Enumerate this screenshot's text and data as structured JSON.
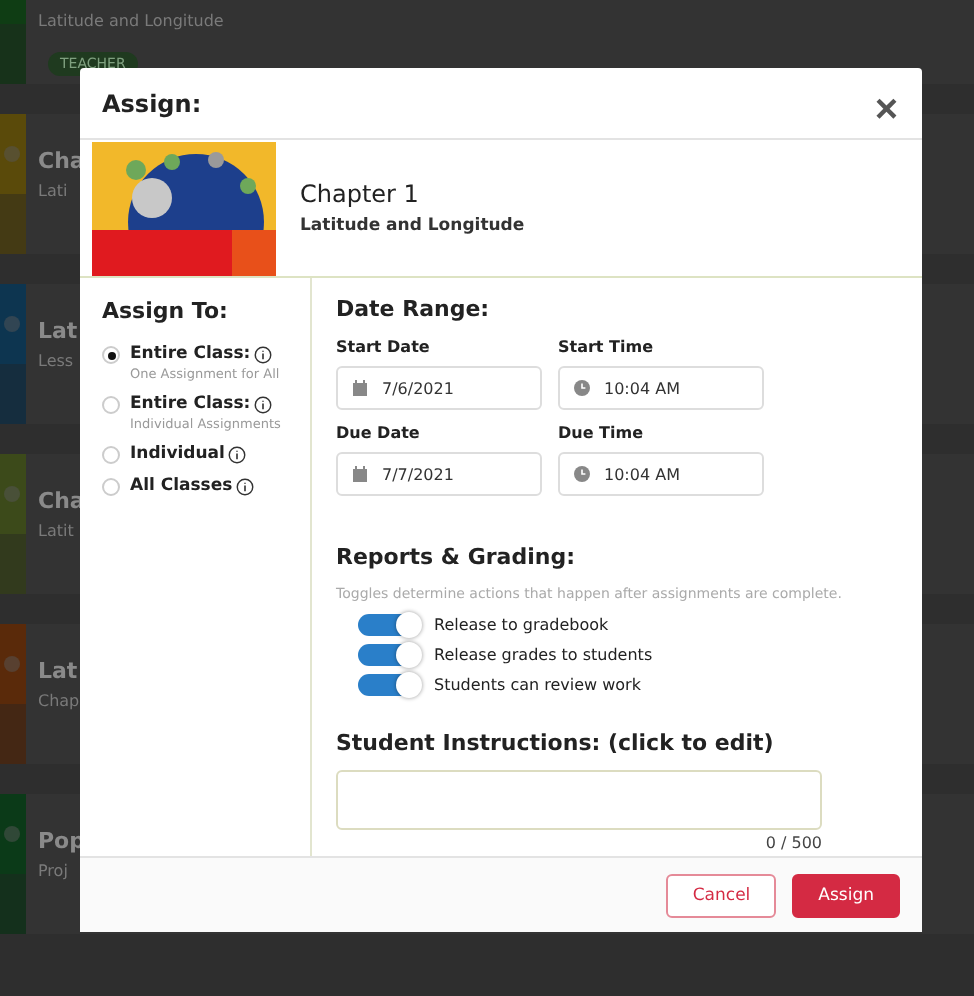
{
  "background_cards": [
    {
      "subtitle": "Latitude and Longitude",
      "badge": "TEACHER"
    },
    {
      "title": "Cha",
      "subtitle": "Lati"
    },
    {
      "title": "Lat",
      "subtitle": "Less"
    },
    {
      "title": "Cha",
      "subtitle": "Latit"
    },
    {
      "title": "Lat",
      "subtitle": "Chap"
    },
    {
      "title": "Pop",
      "subtitle": "Proj"
    }
  ],
  "dialog": {
    "title": "Assign:",
    "close": "×",
    "resource": {
      "title": "Chapter 1",
      "subtitle": "Latitude and Longitude"
    },
    "assign_to": {
      "heading": "Assign To:",
      "options": [
        {
          "label": "Entire Class:",
          "note": "One Assignment for All",
          "selected": true
        },
        {
          "label": "Entire Class:",
          "note": "Individual Assignments",
          "selected": false
        },
        {
          "label": "Individual",
          "selected": false
        },
        {
          "label": "All Classes",
          "selected": false
        }
      ]
    },
    "date_range": {
      "heading": "Date Range:",
      "fields": [
        {
          "label": "Start Date",
          "kind": "date",
          "value": "7/6/2021"
        },
        {
          "label": "Start Time",
          "kind": "time",
          "value": "10:04 AM"
        },
        {
          "label": "Due Date",
          "kind": "date",
          "value": "7/7/2021"
        },
        {
          "label": "Due Time",
          "kind": "time",
          "value": "10:04 AM"
        }
      ]
    },
    "reports": {
      "heading": "Reports & Grading:",
      "note": "Toggles determine actions that happen after assignments are complete.",
      "toggles": [
        {
          "label": "Release to gradebook",
          "on": true
        },
        {
          "label": "Release grades to students",
          "on": true
        },
        {
          "label": "Students can review work",
          "on": true
        }
      ]
    },
    "instructions": {
      "heading": "Student Instructions: (click to edit)",
      "counter": "0 / 500"
    },
    "buttons": [
      {
        "label": "Cancel",
        "kind": "secondary"
      },
      {
        "label": "Assign",
        "kind": "primary"
      }
    ]
  }
}
